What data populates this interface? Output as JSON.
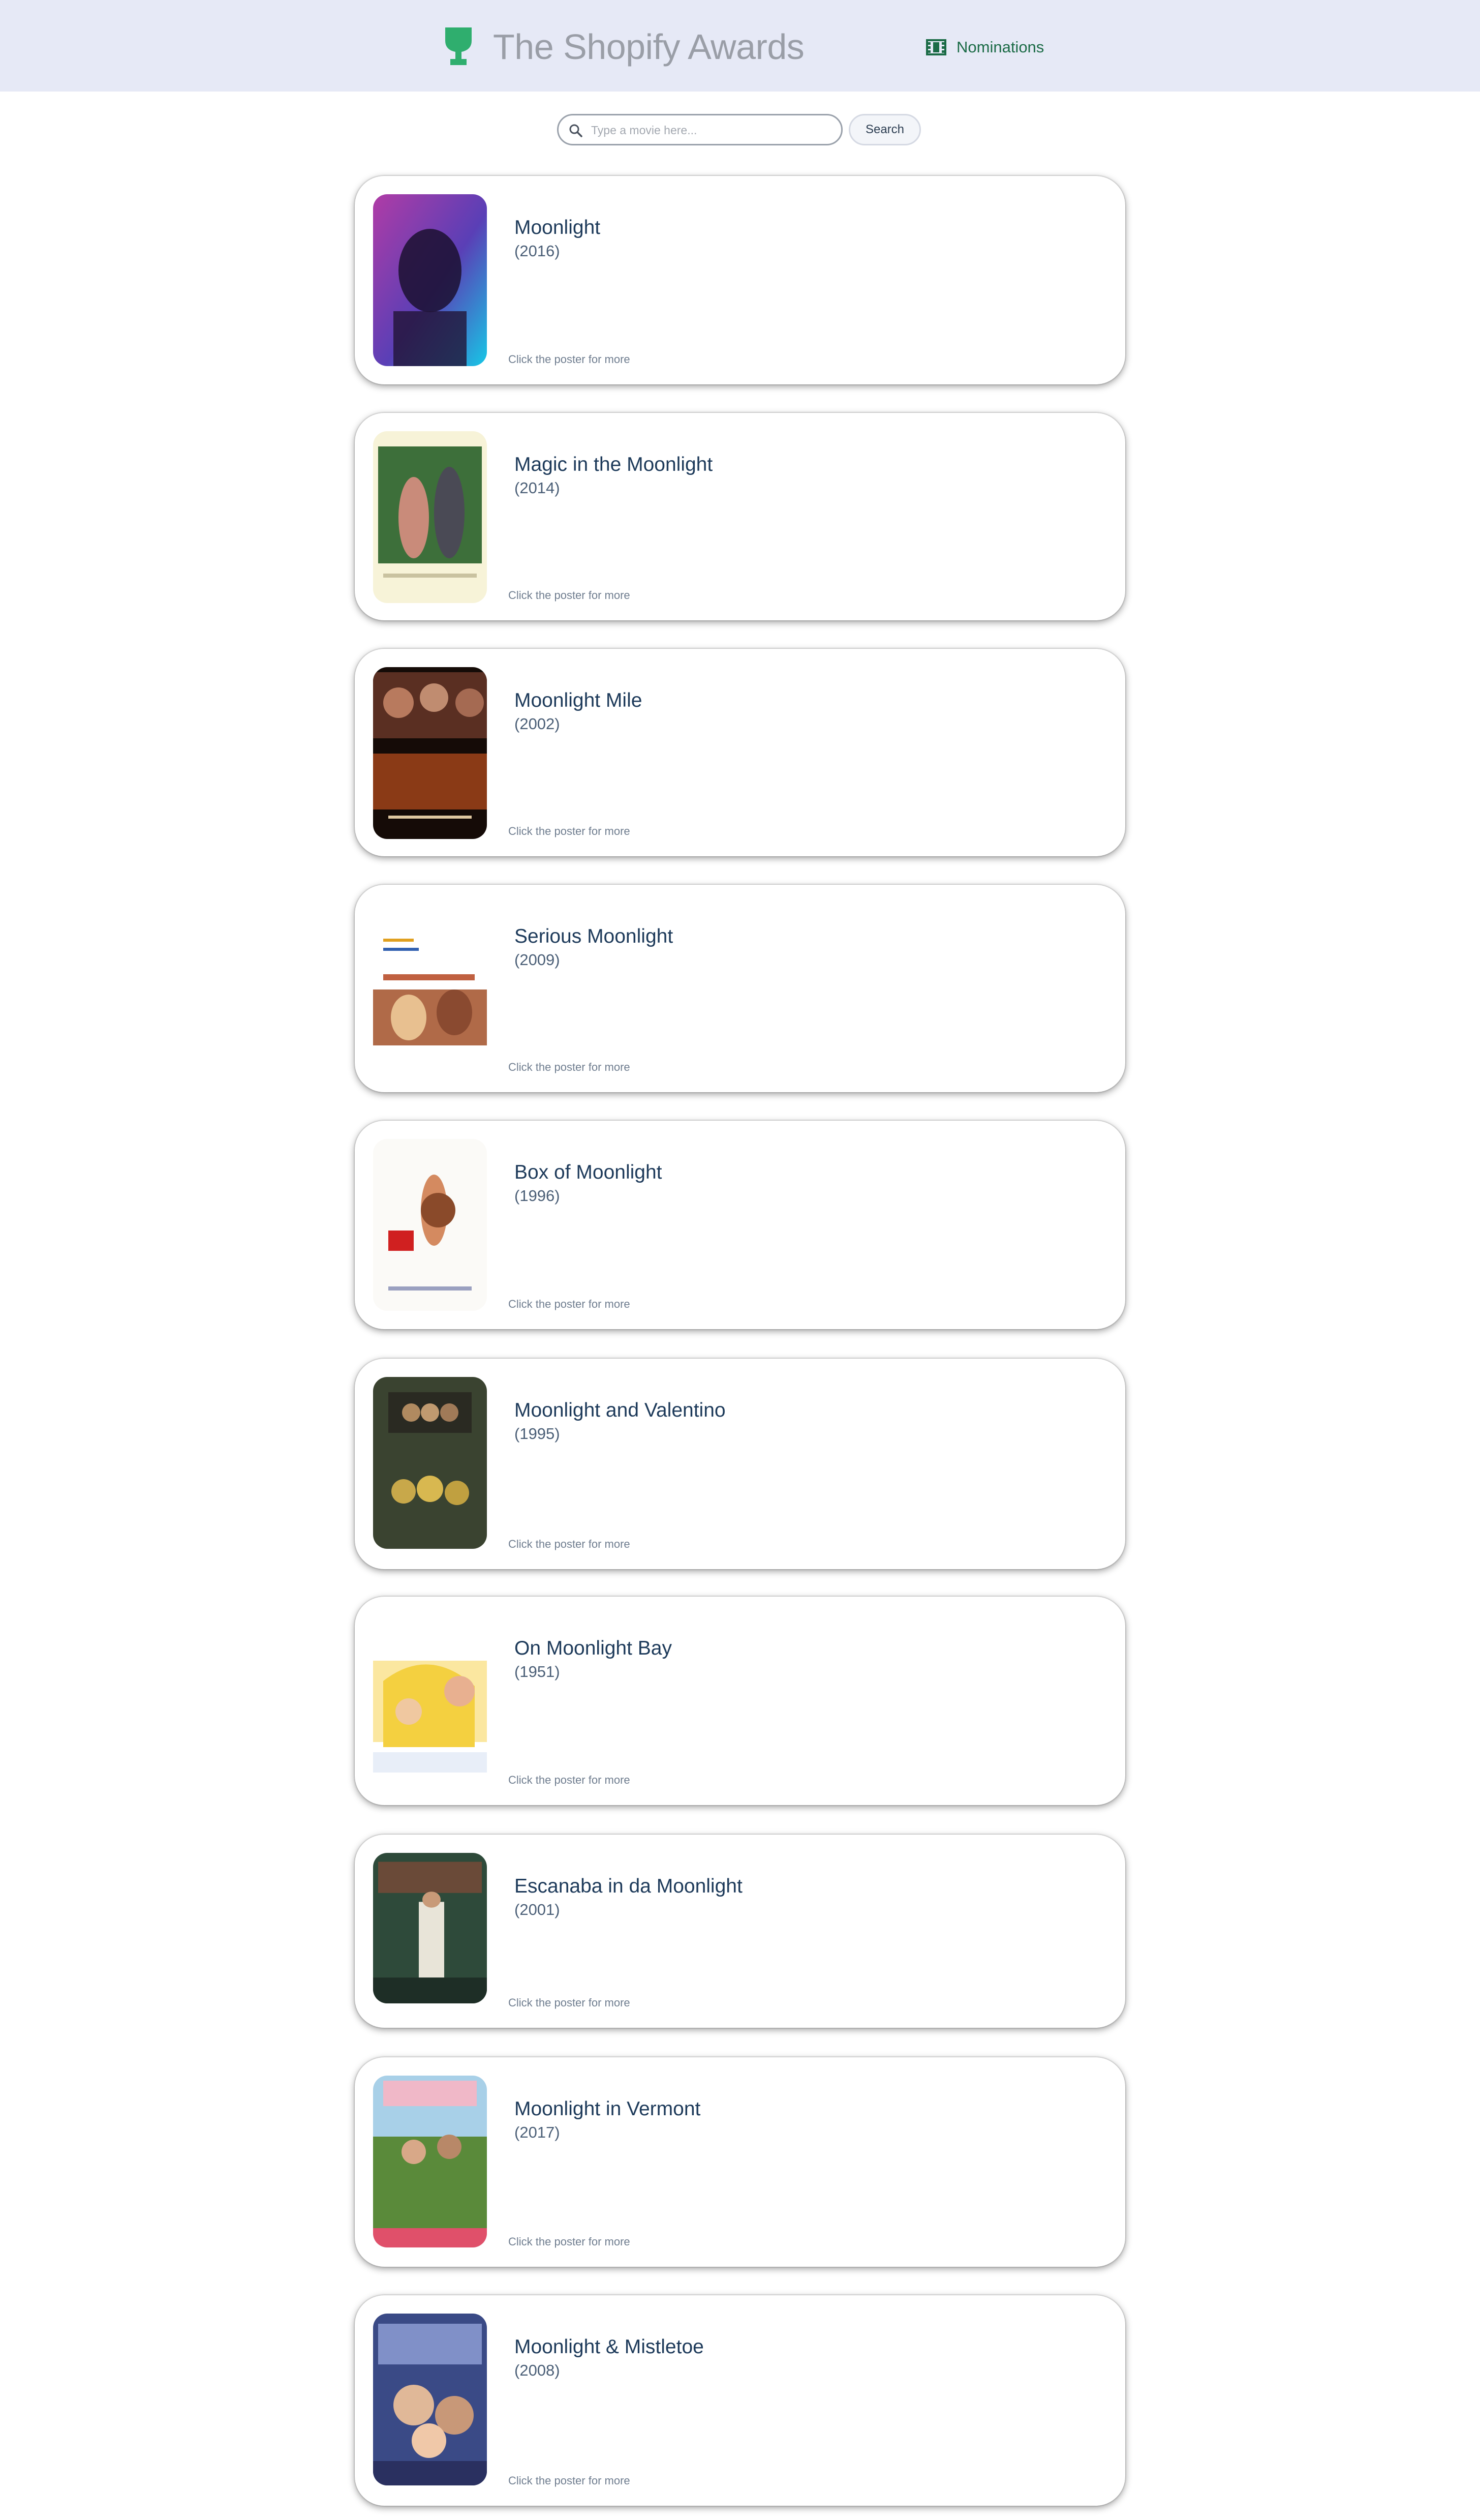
{
  "header": {
    "title": "The Shopify Awards",
    "logo_icon": "trophy-icon",
    "nominations_label": "Nominations",
    "nominations_icon": "film-icon",
    "accent_color": "#2fae6e",
    "background": "#e6e9f6"
  },
  "search": {
    "placeholder": "Type a movie here...",
    "value": "",
    "button_label": "Search",
    "icon": "search-icon"
  },
  "results": [
    {
      "title": "Moonlight",
      "year": "(2016)",
      "hint": "Click the poster for more"
    },
    {
      "title": "Magic in the Moonlight",
      "year": "(2014)",
      "hint": "Click the poster for more"
    },
    {
      "title": "Moonlight Mile",
      "year": "(2002)",
      "hint": "Click the poster for more"
    },
    {
      "title": "Serious Moonlight",
      "year": "(2009)",
      "hint": "Click the poster for more"
    },
    {
      "title": "Box of Moonlight",
      "year": "(1996)",
      "hint": "Click the poster for more"
    },
    {
      "title": "Moonlight and Valentino",
      "year": "(1995)",
      "hint": "Click the poster for more"
    },
    {
      "title": "On Moonlight Bay",
      "year": "(1951)",
      "hint": "Click the poster for more"
    },
    {
      "title": "Escanaba in da Moonlight",
      "year": "(2001)",
      "hint": "Click the poster for more"
    },
    {
      "title": "Moonlight in Vermont",
      "year": "(2017)",
      "hint": "Click the poster for more"
    },
    {
      "title": "Moonlight & Mistletoe",
      "year": "(2008)",
      "hint": "Click the poster for more"
    }
  ]
}
